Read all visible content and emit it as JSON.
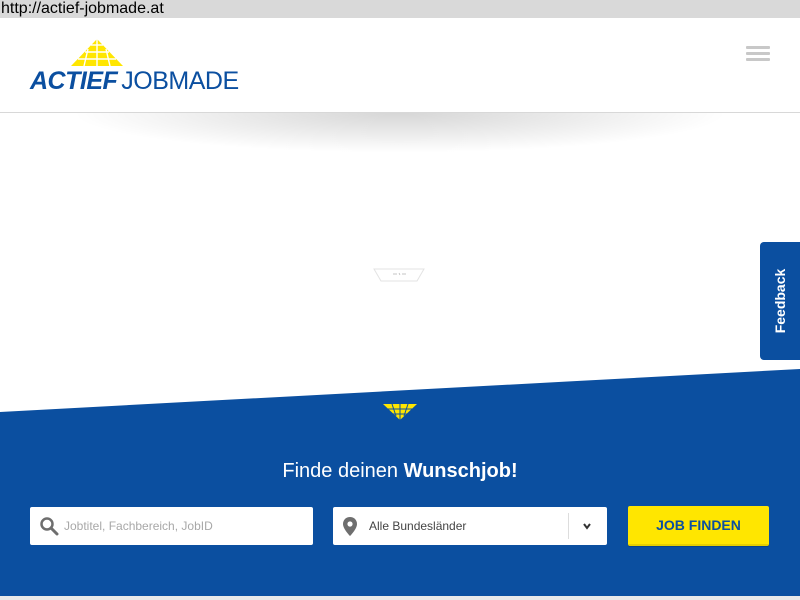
{
  "browser": {
    "url": "http://actief-jobmade.at"
  },
  "header": {
    "logo": {
      "brand_bold": "ACTIEF",
      "brand_regular": "JOBMADE"
    },
    "menu_icon": "hamburger-menu-icon"
  },
  "feedback": {
    "label": "Feedback"
  },
  "search_section": {
    "headline_regular": "Finde deinen ",
    "headline_bold": "Wunschjob!",
    "search_input": {
      "placeholder": "Jobtitel, Fachbereich, JobID",
      "value": ""
    },
    "region_select": {
      "selected": "Alle Bundesländer"
    },
    "submit_label": "JOB FINDEN"
  },
  "colors": {
    "brand_blue": "#0b4fa0",
    "brand_yellow": "#ffe600",
    "header_bg": "#ffffff",
    "urlbar_bg": "#d9d9d9"
  }
}
